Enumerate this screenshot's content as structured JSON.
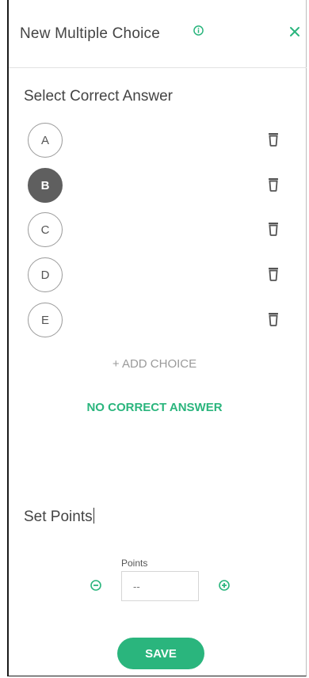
{
  "header": {
    "title": "New Multiple Choice"
  },
  "answers": {
    "section_title": "Select Correct Answer",
    "choices": [
      {
        "label": "A",
        "selected": false
      },
      {
        "label": "B",
        "selected": true
      },
      {
        "label": "C",
        "selected": false
      },
      {
        "label": "D",
        "selected": false
      },
      {
        "label": "E",
        "selected": false
      }
    ],
    "add_choice_label": "+ ADD CHOICE",
    "no_correct_label": "NO CORRECT ANSWER"
  },
  "points": {
    "section_title": "Set Points",
    "field_label": "Points",
    "placeholder": "--",
    "value": ""
  },
  "save_label": "SAVE",
  "colors": {
    "accent": "#2ab57d",
    "selected": "#5f5f5f"
  },
  "icons": [
    "info-icon",
    "close-icon",
    "trash-icon",
    "minus-circle-icon",
    "plus-circle-icon"
  ]
}
